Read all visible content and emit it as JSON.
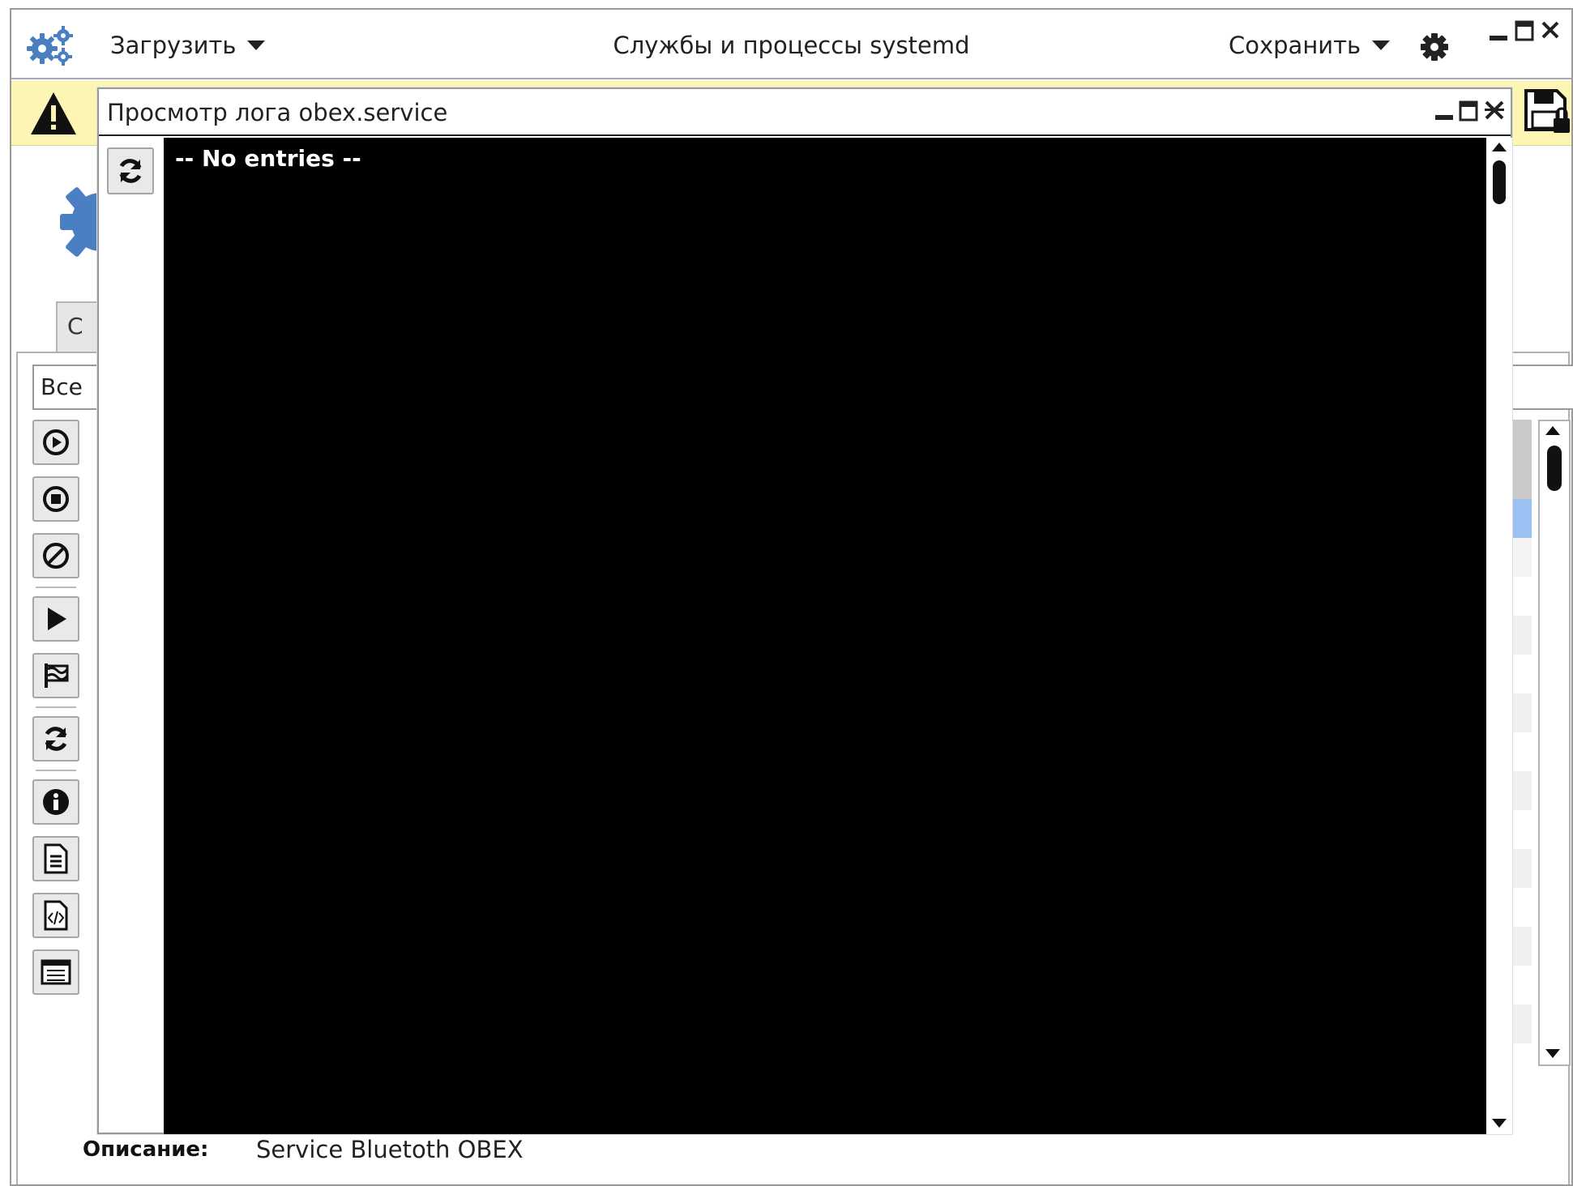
{
  "window": {
    "title": "Службы и процессы systemd",
    "load_menu": "Загрузить",
    "save_menu": "Сохранить"
  },
  "background": {
    "tab_label": "С",
    "filter_value": "Все",
    "description_label": "Описание:",
    "description_value": "Service Bluetoth OBEX"
  },
  "dialog": {
    "title": "Просмотр лога obex.service",
    "log_text": "-- No entries --"
  },
  "colors": {
    "warning_bar": "#fdf5b3",
    "accent_blue": "#4a7fc1",
    "selected_row": "#9cc1f3",
    "log_background": "#000000"
  },
  "icons": {
    "app": "gears-icon",
    "toolbar": [
      "play-circle-icon",
      "stop-circle-icon",
      "disable-icon",
      "play-icon",
      "flag-icon",
      "refresh-icon",
      "info-icon",
      "document-icon",
      "code-document-icon",
      "list-icon"
    ]
  }
}
